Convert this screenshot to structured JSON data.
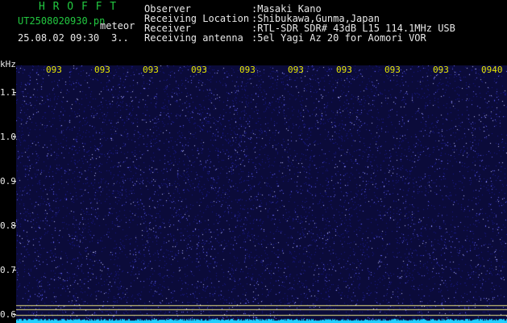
{
  "app": {
    "title": "H R O F F T",
    "file_name": "UT2508020930.pn",
    "file_tag": "meteor",
    "timestamp": "25.08.02 09:30",
    "counter": "3.."
  },
  "info": {
    "labels": [
      "Observer",
      "Receiving Location",
      "Receiver",
      "Receiving antenna"
    ],
    "values": [
      ":Masaki Kano",
      ":Shibukawa,Gunma,Japan",
      ":RTL-SDR SDR# 43dB L15 114.1MHz USB",
      ":5el Yagi Az 20 for Aomori VOR"
    ]
  },
  "chart_data": {
    "type": "heatmap",
    "y_unit": "kHz",
    "yticks": [
      "1.1",
      "1.0",
      "0.9",
      "0.8",
      "0.7",
      "0.6"
    ],
    "y_values": [
      1.1,
      1.0,
      0.9,
      0.8,
      0.7,
      0.6
    ],
    "ylim": [
      0.58,
      1.16
    ],
    "xticks": [
      "093",
      "093",
      "093",
      "093",
      "093",
      "093",
      "093",
      "093",
      "093",
      "0940"
    ],
    "marker_lines_khz": [
      0.62,
      0.61,
      0.598
    ],
    "colors": {
      "background": "#0b0b3a",
      "noise_low": "#1a1a8a",
      "noise_high": "#6a6aff",
      "marker_line": "#e8e080",
      "baseline": "#20d0ff"
    }
  }
}
